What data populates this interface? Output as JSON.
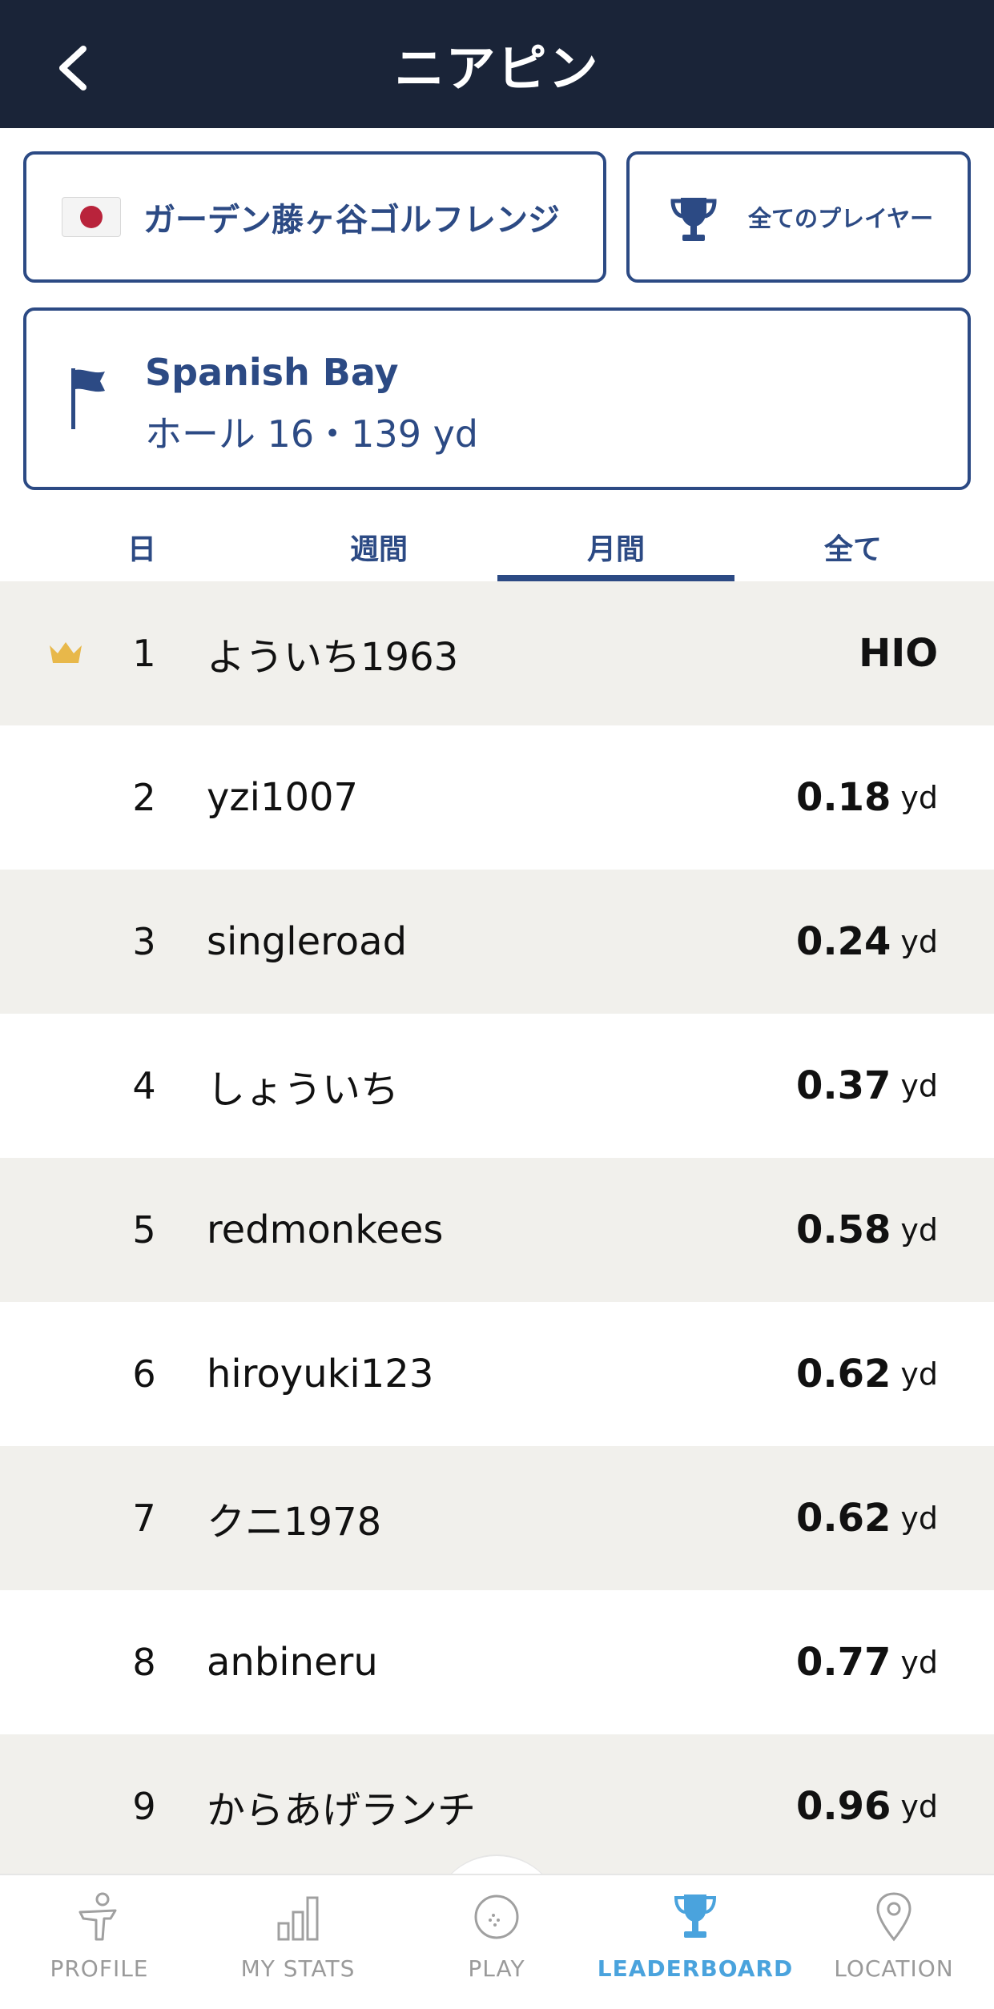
{
  "header": {
    "title": "ニアピン",
    "back_icon": "chevron-left-icon"
  },
  "filters": {
    "range_label": "ガーデン藤ヶ谷ゴルフレンジ",
    "range_flag": "japan-flag",
    "players_label": "全てのプレイヤー",
    "players_icon": "trophy-icon"
  },
  "hole": {
    "course": "Spanish Bay",
    "info": "ホール 16・139 yd",
    "icon": "flag-icon"
  },
  "tabs": [
    {
      "label": "日",
      "active": false
    },
    {
      "label": "週間",
      "active": false
    },
    {
      "label": "月間",
      "active": true
    },
    {
      "label": "全て",
      "active": false
    }
  ],
  "leaderboard": [
    {
      "rank": "1",
      "name": "よういち1963",
      "score": "HIO",
      "unit": "",
      "crown": true
    },
    {
      "rank": "2",
      "name": "yzi1007",
      "score": "0.18",
      "unit": "yd"
    },
    {
      "rank": "3",
      "name": "singleroad",
      "score": "0.24",
      "unit": "yd"
    },
    {
      "rank": "4",
      "name": "しょういち",
      "score": "0.37",
      "unit": "yd"
    },
    {
      "rank": "5",
      "name": "redmonkees",
      "score": "0.58",
      "unit": "yd"
    },
    {
      "rank": "6",
      "name": "hiroyuki123",
      "score": "0.62",
      "unit": "yd"
    },
    {
      "rank": "7",
      "name": "クニ1978",
      "score": "0.62",
      "unit": "yd"
    },
    {
      "rank": "8",
      "name": "anbineru",
      "score": "0.77",
      "unit": "yd"
    },
    {
      "rank": "9",
      "name": "からあげランチ",
      "score": "0.96",
      "unit": "yd"
    }
  ],
  "nav": [
    {
      "label": "PROFILE",
      "icon": "golfer-icon",
      "active": false
    },
    {
      "label": "MY STATS",
      "icon": "bar-chart-icon",
      "active": false
    },
    {
      "label": "PLAY",
      "icon": "golf-ball-icon",
      "active": false
    },
    {
      "label": "LEADERBOARD",
      "icon": "trophy-icon",
      "active": true
    },
    {
      "label": "LOCATION",
      "icon": "location-pin-icon",
      "active": false
    }
  ],
  "colors": {
    "header_bg": "#1a2438",
    "primary": "#2c4a84",
    "row_alt": "#f1f0ec",
    "nav_active": "#4aa3dd",
    "nav_inactive": "#9a9a9a",
    "crown": "#e8b84a"
  }
}
